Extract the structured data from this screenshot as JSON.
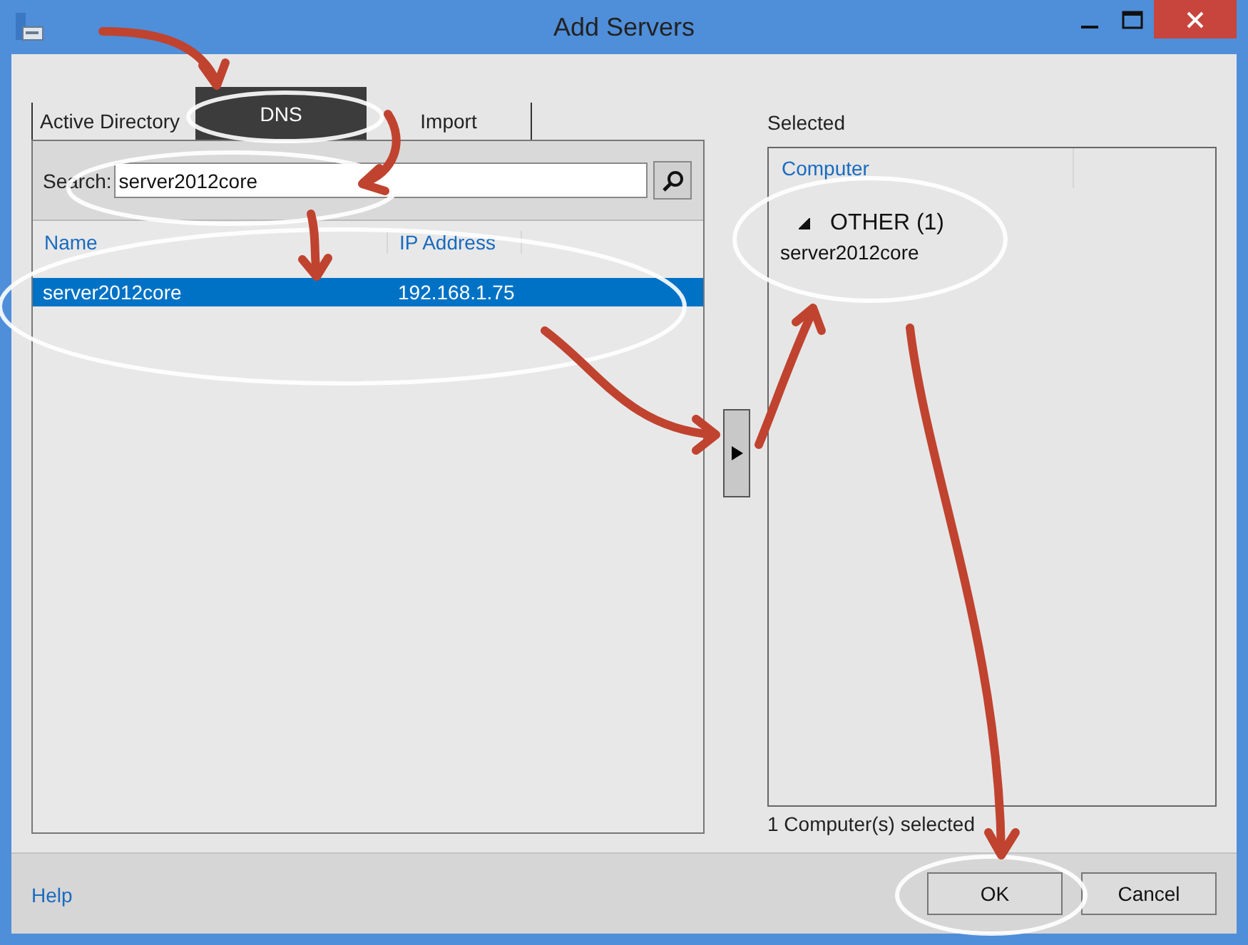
{
  "window": {
    "title": "Add Servers"
  },
  "tabs": [
    {
      "label": "Active Directory",
      "selected": false
    },
    {
      "label": "DNS",
      "selected": true
    },
    {
      "label": "Import",
      "selected": false
    }
  ],
  "search": {
    "label": "Search:",
    "value": "server2012core"
  },
  "results": {
    "columns": [
      "Name",
      "IP Address"
    ],
    "rows": [
      {
        "cells": [
          "server2012core",
          "192.168.1.75"
        ],
        "selected": true
      }
    ]
  },
  "selected_panel": {
    "title": "Selected",
    "columns": [
      "Computer"
    ],
    "groups": [
      {
        "label": "OTHER (1)",
        "expanded": true,
        "items": [
          "server2012core"
        ]
      }
    ],
    "status": "1 Computer(s) selected"
  },
  "footer": {
    "help": "Help",
    "buttons": [
      "OK",
      "Cancel"
    ]
  }
}
